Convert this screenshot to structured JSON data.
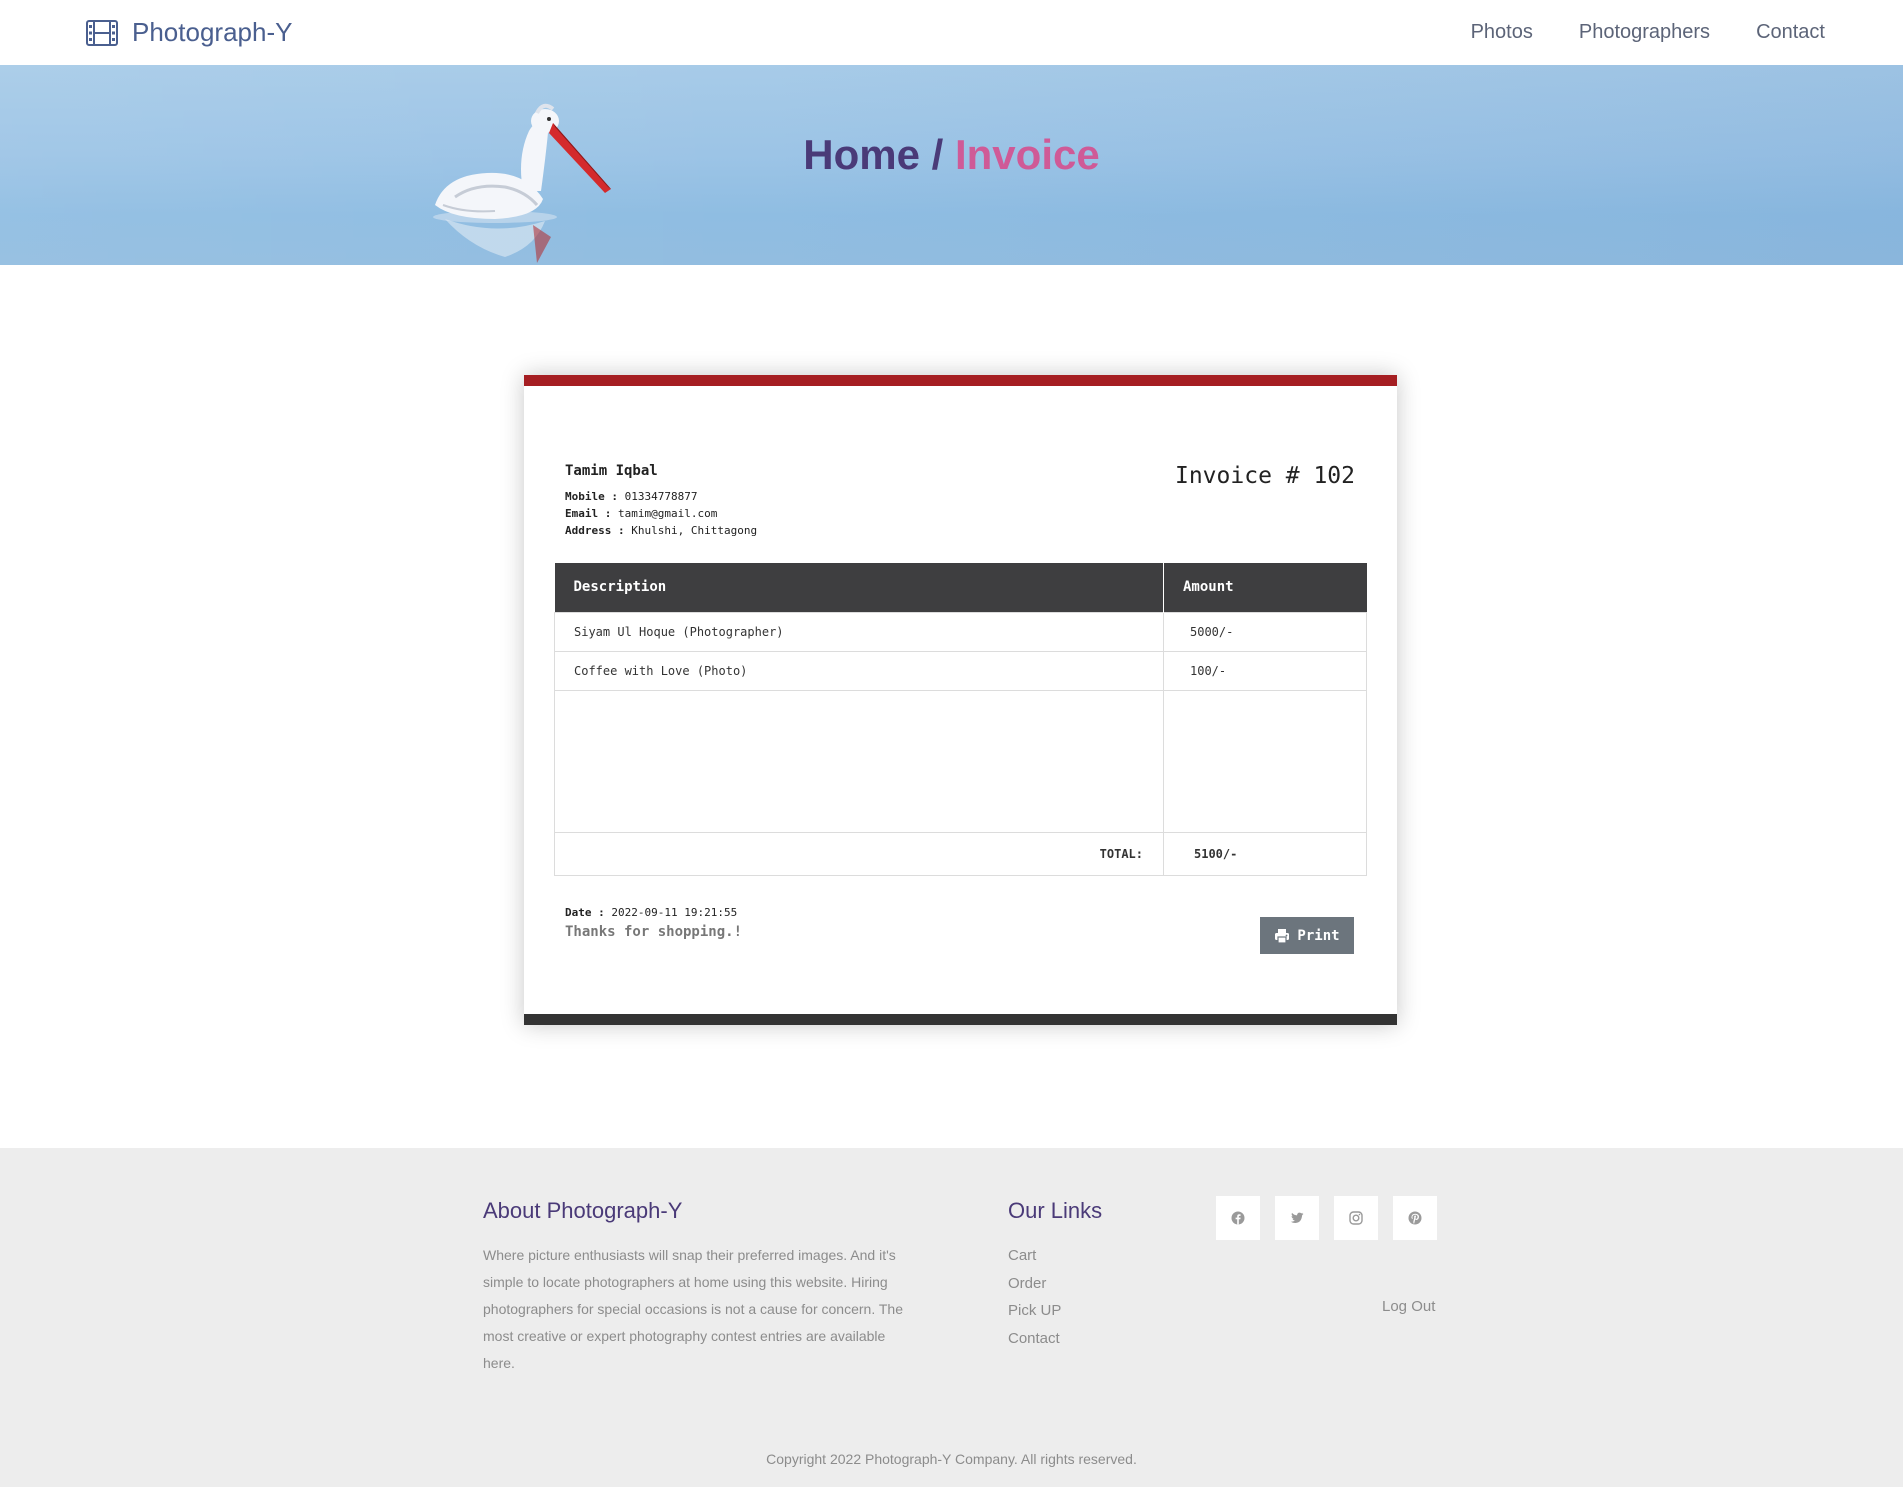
{
  "navbar": {
    "brand": "Photograph-Y",
    "brand_icon": "film-icon",
    "links": [
      "Photos",
      "Photographers",
      "Contact"
    ]
  },
  "hero": {
    "breadcrumb_home": "Home",
    "breadcrumb_sep": " / ",
    "breadcrumb_current": "Invoice",
    "image": "pelican-on-water"
  },
  "invoice": {
    "customer_name": "Tamim Iqbal",
    "mobile_label": "Mobile :",
    "mobile": "01334778877",
    "email_label": "Email :",
    "email": "tamim@gmail.com",
    "address_label": "Address :",
    "address": "Khulshi, Chittagong",
    "invoice_number": "Invoice # 102",
    "columns": [
      "Description",
      "Amount"
    ],
    "items": [
      {
        "description": "Siyam Ul Hoque (Photographer)",
        "amount": "5000/-"
      },
      {
        "description": "Coffee with Love (Photo)",
        "amount": "100/-"
      }
    ],
    "total_label": "TOTAL:",
    "total_value": "5100/-",
    "date_label": "Date :",
    "date": "2022-09-11 19:21:55",
    "thanks": "Thanks for shopping.!",
    "print_label": "Print",
    "colors": {
      "top_bar": "#a51e22",
      "bottom_bar": "#333333",
      "total": "#d3263a"
    }
  },
  "footer": {
    "about_title": "About Photograph-Y",
    "about_text": "Where picture enthusiasts will snap their preferred images. And it's simple to locate photographers at home using this website. Hiring photographers for special occasions is not a cause for concern. The most creative or expert photography contest entries are available here.",
    "links_title": "Our Links",
    "links": [
      "Cart",
      "Order",
      "Pick UP",
      "Contact"
    ],
    "social": [
      "facebook-icon",
      "twitter-icon",
      "instagram-icon",
      "pinterest-icon"
    ],
    "logout": "Log Out",
    "copyright": "Copyright 2022 Photograph-Y Company. All rights reserved."
  }
}
